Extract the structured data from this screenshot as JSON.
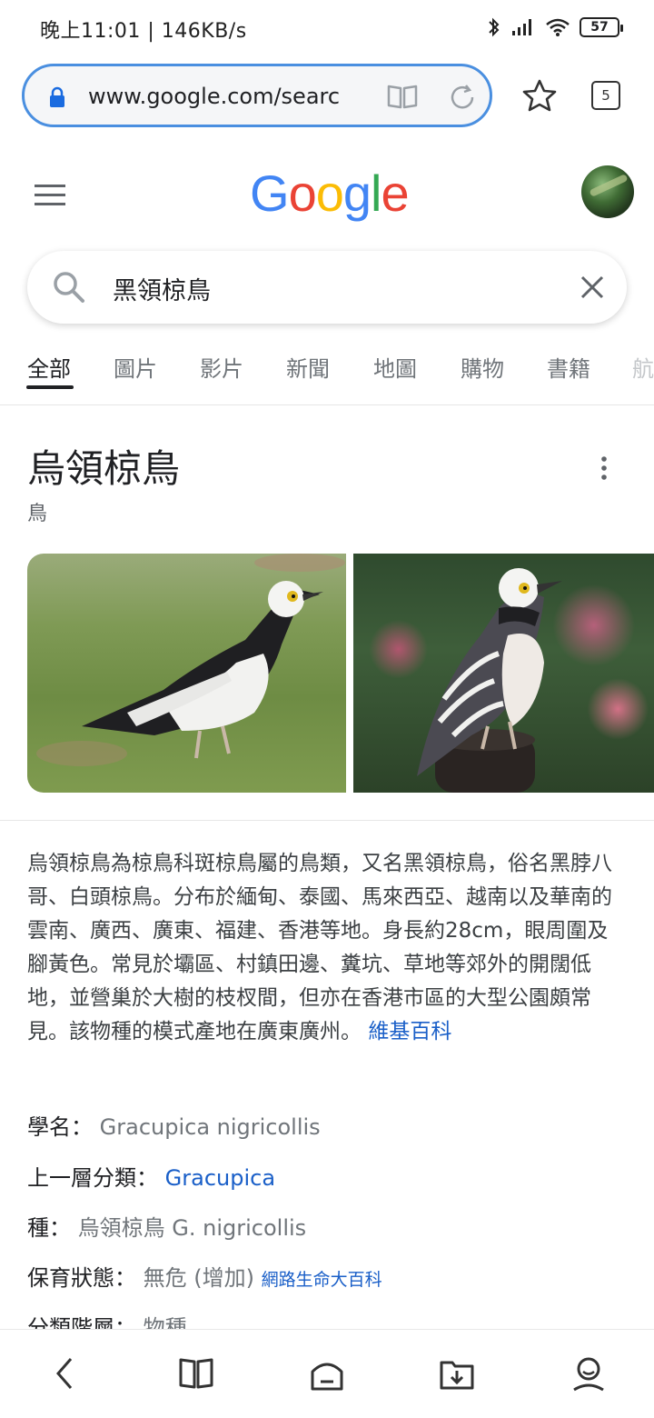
{
  "status_bar": {
    "time_speed": "晚上11:01 | 146KB/s",
    "battery": "57"
  },
  "browser": {
    "url": "www.google.com/searc",
    "tab_count": "5"
  },
  "search": {
    "query": "黑領椋鳥"
  },
  "tabs": [
    {
      "label": "全部"
    },
    {
      "label": "圖片"
    },
    {
      "label": "影片"
    },
    {
      "label": "新聞"
    },
    {
      "label": "地圖"
    },
    {
      "label": "購物"
    },
    {
      "label": "書籍"
    },
    {
      "label": "航"
    }
  ],
  "knowledge_panel": {
    "title": "烏領椋鳥",
    "subtitle": "鳥",
    "description": "烏領椋鳥為椋鳥科斑椋鳥屬的鳥類，又名黑領椋鳥，俗名黑脖八哥、白頭椋鳥。分布於緬甸、泰國、馬來西亞、越南以及華南的雲南、廣西、廣東、福建、香港等地。身長約28cm，眼周圍及腳黃色。常見於壩區、村鎮田邊、糞坑、草地等郊外的開闊低地，並營巢於大樹的枝杈間，但亦在香港市區的大型公園頗常見。該物種的模式產地在廣東廣州。",
    "source_link": "維基百科",
    "facts": {
      "scientific_name_label": "學名：",
      "scientific_name_value": "Gracupica nigricollis",
      "parent_taxon_label": "上一層分類：",
      "parent_taxon_value": "Gracupica",
      "species_label": "種：",
      "species_value": "烏領椋鳥 G. nigricollis",
      "conservation_label": "保育狀態：",
      "conservation_value": "無危 (增加)",
      "conservation_source": "網路生命大百科",
      "rank_label": "分類階層：",
      "rank_value": "物種"
    }
  },
  "colors": {
    "link_blue": "#1a5fc8",
    "url_border": "#4a8fe0",
    "google_blue": "#4285F4",
    "google_red": "#EA4335",
    "google_yellow": "#FBBC05",
    "google_green": "#34A853"
  },
  "icons": [
    "lock-icon",
    "reader-icon",
    "reload-icon",
    "star-icon",
    "menu-icon",
    "search-icon",
    "close-icon",
    "more-vert-icon",
    "back-icon",
    "bookmarks-icon",
    "home-icon",
    "downloads-icon",
    "profile-icon"
  ]
}
